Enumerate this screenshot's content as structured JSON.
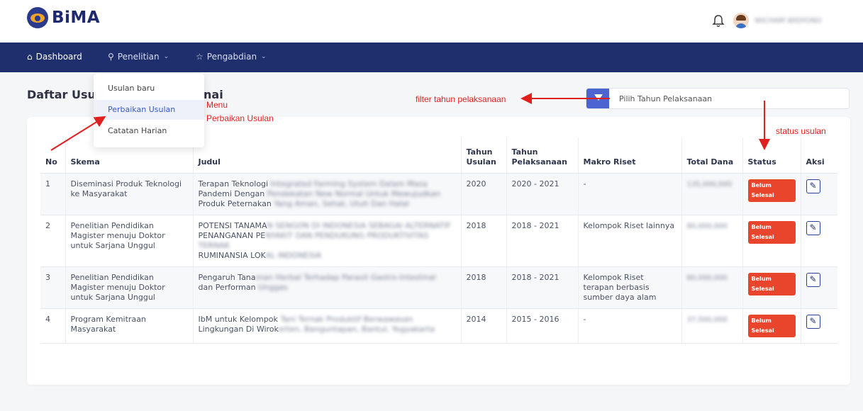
{
  "header": {
    "logo_text": "BiMA",
    "user_name": "WICHAM WIDYONO"
  },
  "nav": {
    "dashboard": "Dashboard",
    "penelitian": "Penelitian",
    "pengabdian": "Pengabdian"
  },
  "dropdown": {
    "items": [
      "Usulan baru",
      "Perbaikan Usulan",
      "Catatan Harian"
    ]
  },
  "page": {
    "title_start": "Daftar Usul",
    "title_end": "nai"
  },
  "filter": {
    "placeholder": "Pilih Tahun Pelaksanaan"
  },
  "table": {
    "columns": [
      "No",
      "Skema",
      "Judul",
      "Tahun Usulan",
      "Tahun Pelaksanaan",
      "Makro Riset",
      "Total Dana",
      "Status",
      "Aksi"
    ],
    "rows": [
      {
        "no": "1",
        "skema": "Diseminasi Produk Teknologi ke Masyarakat",
        "judul_visible": "Terapan Teknologi",
        "judul_blur": "Integrated Farming System Dalam Masa",
        "judul_line2_visible": "Pandemi Dengan",
        "judul_line2_blur": "Pendekatan New Normal Untuk Mewujudkan",
        "judul_line3_visible": "Produk Peternakan",
        "judul_line3_blur": "Yang Aman, Sehat, Utuh Dan Halal",
        "tahun_usulan": "2020",
        "tahun_pelaksanaan": "2020 - 2021",
        "makro_riset": "-",
        "total_dana": "135,000,000",
        "status": "Belum Selesai"
      },
      {
        "no": "2",
        "skema": "Penelitian Pendidikan Magister menuju Doktor untuk Sarjana Unggul",
        "judul_visible": "POTENSI TANAMA",
        "judul_blur": "N SENGON DI INDONESIA SEBAGAI ALTERNATIF",
        "judul_line2_visible": "PENANGANAN PE",
        "judul_line2_blur": "NYAKIT DAN PENDUKUNG PRODUKTIVITAS TERNAK",
        "judul_line3_visible": "RUMINANSIA LOK",
        "judul_line3_blur": "AL INDONESIA",
        "tahun_usulan": "2018",
        "tahun_pelaksanaan": "2018 - 2021",
        "makro_riset": "Kelompok Riset lainnya",
        "total_dana": "80,000,000",
        "status": "Belum Selesai"
      },
      {
        "no": "3",
        "skema": "Penelitian Pendidikan Magister menuju Doktor untuk Sarjana Unggul",
        "judul_visible": "Pengaruh Tana",
        "judul_blur": "man Herbal Terhadap Parasit Gastro-Intestinal",
        "judul_line2_visible": "dan Performan",
        "judul_line2_blur": "Unggas",
        "judul_line3_visible": "",
        "judul_line3_blur": "",
        "tahun_usulan": "2018",
        "tahun_pelaksanaan": "2018 - 2021",
        "makro_riset": "Kelompok Riset terapan berbasis sumber daya alam",
        "total_dana": "80,000,000",
        "status": "Belum Selesai"
      },
      {
        "no": "4",
        "skema": "Program Kemitraan Masyarakat",
        "judul_visible": "IbM untuk Kelompok",
        "judul_blur": "Tani Ternak Produktif Berwawasan",
        "judul_line2_visible": "Lingkungan Di Wirok",
        "judul_line2_blur": "erten, Banguntapan, Bantul, Yogyakarta",
        "judul_line3_visible": "",
        "judul_line3_blur": "",
        "tahun_usulan": "2014",
        "tahun_pelaksanaan": "2015 - 2016",
        "makro_riset": "-",
        "total_dana": "37,500,000",
        "status": "Belum Selesai"
      }
    ]
  },
  "annotations": {
    "menu_line1": "Menu",
    "menu_line2": "Perbaikan Usulan",
    "filter_note": "filter tahun pelaksanaan",
    "status_note": "status usulan"
  },
  "colors": {
    "navbar": "#1f2e6d",
    "accent": "#4b64cf",
    "badge": "#e9452c",
    "annotation": "#e21f1f"
  }
}
